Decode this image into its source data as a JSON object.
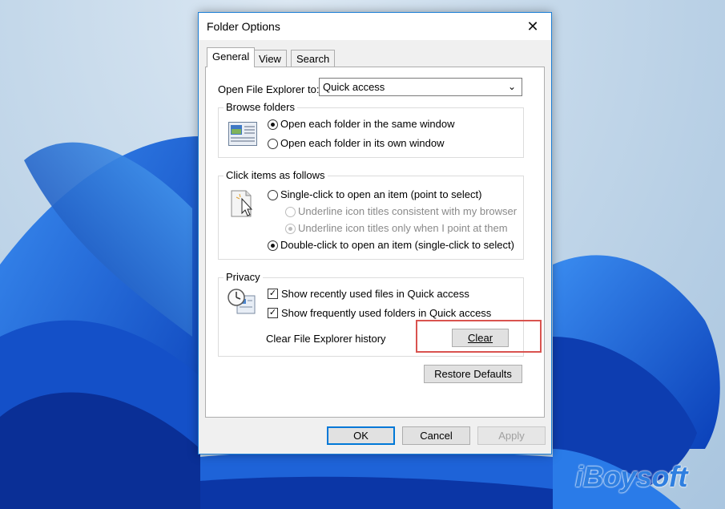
{
  "dialog": {
    "title": "Folder Options",
    "close_glyph": "✕"
  },
  "tabs": [
    {
      "label": "General",
      "active": true
    },
    {
      "label": "View",
      "active": false
    },
    {
      "label": "Search",
      "active": false
    }
  ],
  "open_explorer": {
    "label": "Open File Explorer to:",
    "value": "Quick access"
  },
  "browse_folders": {
    "title": "Browse folders",
    "options": [
      {
        "label": "Open each folder in the same window",
        "checked": true
      },
      {
        "label": "Open each folder in its own window",
        "checked": false
      }
    ]
  },
  "click_items": {
    "title": "Click items as follows",
    "single_click": "Single-click to open an item (point to select)",
    "underline_browser": "Underline icon titles consistent with my browser",
    "underline_point": "Underline icon titles only when I point at them",
    "double_click": "Double-click to open an item (single-click to select)"
  },
  "privacy": {
    "title": "Privacy",
    "recent_files": "Show recently used files in Quick access",
    "frequent_folders": "Show frequently used folders in Quick access",
    "clear_label": "Clear File Explorer history",
    "clear_button": "Clear"
  },
  "buttons": {
    "restore": "Restore Defaults",
    "ok": "OK",
    "cancel": "Cancel",
    "apply": "Apply"
  },
  "watermark": "iBoysoft",
  "colors": {
    "accent": "#0078d7",
    "highlight": "#d9534f",
    "watermark": "#2f7fe0"
  }
}
